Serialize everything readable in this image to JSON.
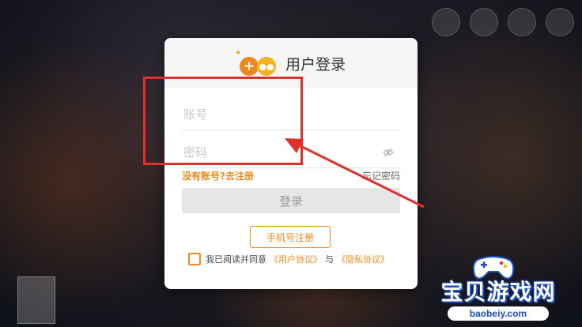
{
  "dialog": {
    "title": "用户登录",
    "account_placeholder": "账号",
    "password_placeholder": "密码",
    "register_link": "没有账号?去注册",
    "forgot_link": "忘记密码",
    "login_button": "登录",
    "phone_register_button": "手机号注册",
    "agree_text": "我已阅读并同意",
    "user_agreement": "《用户协议》",
    "and_text": "与",
    "privacy_agreement": "《隐私协议》"
  },
  "watermark": {
    "title": "宝贝游戏网",
    "url": "baobeiy.com"
  },
  "colors": {
    "accent": "#f08a1c",
    "annotation": "#e0302a",
    "watermark_blue": "#1c4fbf"
  }
}
